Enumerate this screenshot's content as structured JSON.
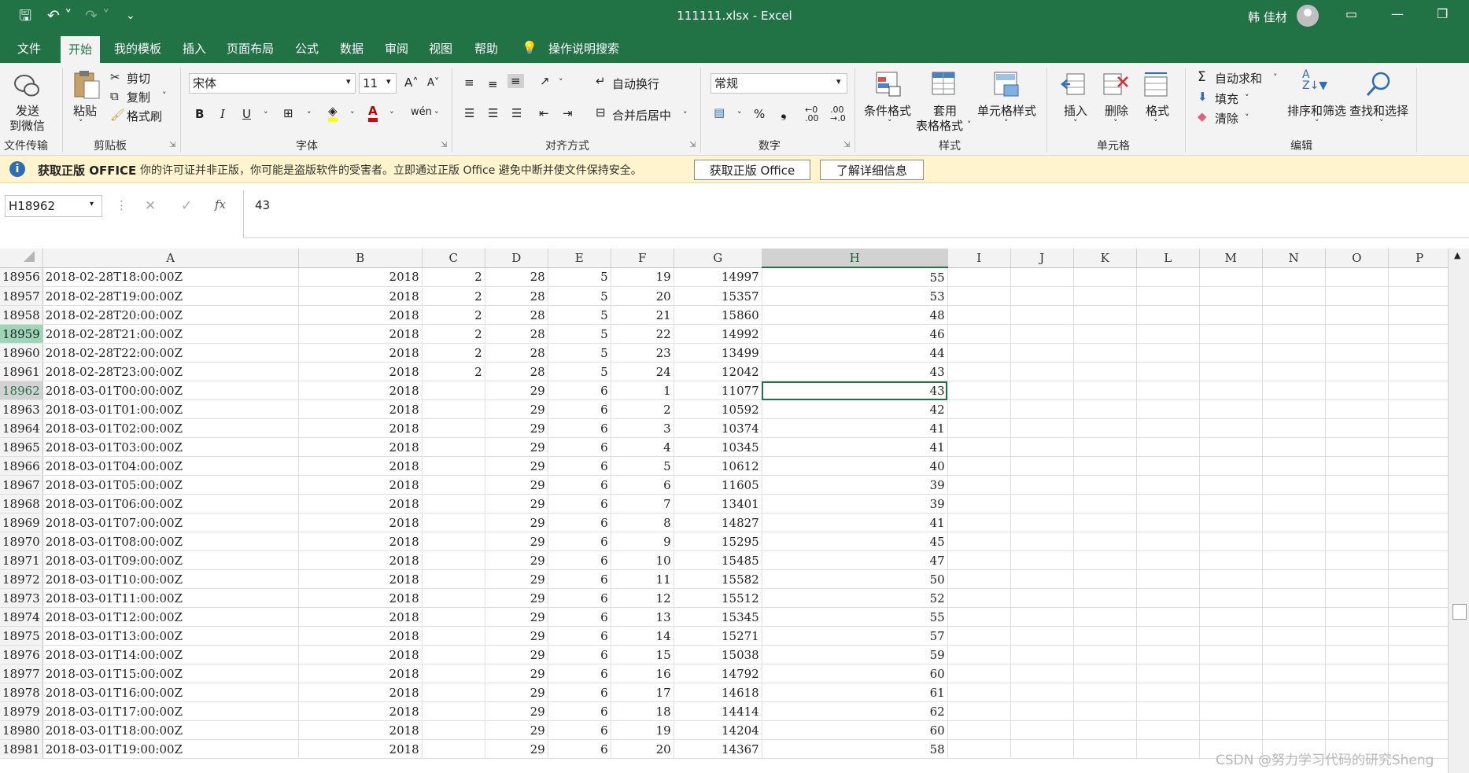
{
  "titlebar": {
    "title": "111111.xlsx  -  Excel",
    "user": "韩 佳材",
    "qa_save": "🖫",
    "qa_undo": "↶ ˅",
    "qa_redo": "↷ ˅",
    "qa_more": "⌄",
    "win_ribbon_opts": "▭",
    "win_min": "—",
    "win_max": "❐"
  },
  "tabs": [
    "文件",
    "开始",
    "我的模板",
    "插入",
    "页面布局",
    "公式",
    "数据",
    "审阅",
    "视图",
    "帮助",
    "操作说明搜索"
  ],
  "active_tab": "开始",
  "ribbon": {
    "send_wechat_1": "发送",
    "send_wechat_2": "到微信",
    "paste": "粘贴",
    "cut": "剪切",
    "copy": "复制",
    "format_painter": "格式刷",
    "font_name": "宋体",
    "font_size": "11",
    "grow": "A˄",
    "shrink": "A˅",
    "bold": "B",
    "italic": "I",
    "underline": "U",
    "wrap_text": "自动换行",
    "merge_center": "合并后居中",
    "number_format": "常规",
    "percent": "%",
    "comma": "❟",
    "cond_format": "条件格式",
    "table_format_1": "套用",
    "table_format_2": "表格格式",
    "cell_styles": "单元格样式",
    "insert": "插入",
    "delete": "删除",
    "format": "格式",
    "autosum": "自动求和",
    "fill": "填充",
    "clear": "清除",
    "sort_filter": "排序和筛选",
    "find_select": "查找和选择",
    "groups": {
      "file_transfer": "文件传输",
      "clipboard": "剪贴板",
      "font": "字体",
      "alignment": "对齐方式",
      "number": "数字",
      "styles": "样式",
      "cells": "单元格",
      "editing": "编辑"
    }
  },
  "notice": {
    "title": "获取正版 OFFICE",
    "text": "你的许可证并非正版，你可能是盗版软件的受害者。立即通过正版 Office 避免中断并使文件保持安全。",
    "button1": "获取正版 Office",
    "button2": "了解详细信息"
  },
  "formula_bar": {
    "name_box": "H18962",
    "value": "43",
    "fx": "fx",
    "cancel": "✕",
    "enter": "✓"
  },
  "columns": [
    "A",
    "B",
    "C",
    "D",
    "E",
    "F",
    "G",
    "H",
    "I",
    "J",
    "K",
    "L",
    "M",
    "N",
    "O",
    "P"
  ],
  "selected_column": "H",
  "rows": [
    {
      "r": "18956",
      "a": "2018-02-28T18:00:00Z",
      "b": "2018",
      "c": "2",
      "d": "28",
      "e": "5",
      "f": "19",
      "g": "14997",
      "h": "55"
    },
    {
      "r": "18957",
      "a": "2018-02-28T19:00:00Z",
      "b": "2018",
      "c": "2",
      "d": "28",
      "e": "5",
      "f": "20",
      "g": "15357",
      "h": "53"
    },
    {
      "r": "18958",
      "a": "2018-02-28T20:00:00Z",
      "b": "2018",
      "c": "2",
      "d": "28",
      "e": "5",
      "f": "21",
      "g": "15860",
      "h": "48"
    },
    {
      "r": "18959",
      "a": "2018-02-28T21:00:00Z",
      "b": "2018",
      "c": "2",
      "d": "28",
      "e": "5",
      "f": "22",
      "g": "14992",
      "h": "46"
    },
    {
      "r": "18960",
      "a": "2018-02-28T22:00:00Z",
      "b": "2018",
      "c": "2",
      "d": "28",
      "e": "5",
      "f": "23",
      "g": "13499",
      "h": "44"
    },
    {
      "r": "18961",
      "a": "2018-02-28T23:00:00Z",
      "b": "2018",
      "c": "2",
      "d": "28",
      "e": "5",
      "f": "24",
      "g": "12042",
      "h": "43"
    },
    {
      "r": "18962",
      "a": "2018-03-01T00:00:00Z",
      "b": "2018",
      "c": "",
      "d": "29",
      "e": "6",
      "f": "1",
      "g": "11077",
      "h": "43"
    },
    {
      "r": "18963",
      "a": "2018-03-01T01:00:00Z",
      "b": "2018",
      "c": "",
      "d": "29",
      "e": "6",
      "f": "2",
      "g": "10592",
      "h": "42"
    },
    {
      "r": "18964",
      "a": "2018-03-01T02:00:00Z",
      "b": "2018",
      "c": "",
      "d": "29",
      "e": "6",
      "f": "3",
      "g": "10374",
      "h": "41"
    },
    {
      "r": "18965",
      "a": "2018-03-01T03:00:00Z",
      "b": "2018",
      "c": "",
      "d": "29",
      "e": "6",
      "f": "4",
      "g": "10345",
      "h": "41"
    },
    {
      "r": "18966",
      "a": "2018-03-01T04:00:00Z",
      "b": "2018",
      "c": "",
      "d": "29",
      "e": "6",
      "f": "5",
      "g": "10612",
      "h": "40"
    },
    {
      "r": "18967",
      "a": "2018-03-01T05:00:00Z",
      "b": "2018",
      "c": "",
      "d": "29",
      "e": "6",
      "f": "6",
      "g": "11605",
      "h": "39"
    },
    {
      "r": "18968",
      "a": "2018-03-01T06:00:00Z",
      "b": "2018",
      "c": "",
      "d": "29",
      "e": "6",
      "f": "7",
      "g": "13401",
      "h": "39"
    },
    {
      "r": "18969",
      "a": "2018-03-01T07:00:00Z",
      "b": "2018",
      "c": "",
      "d": "29",
      "e": "6",
      "f": "8",
      "g": "14827",
      "h": "41"
    },
    {
      "r": "18970",
      "a": "2018-03-01T08:00:00Z",
      "b": "2018",
      "c": "",
      "d": "29",
      "e": "6",
      "f": "9",
      "g": "15295",
      "h": "45"
    },
    {
      "r": "18971",
      "a": "2018-03-01T09:00:00Z",
      "b": "2018",
      "c": "",
      "d": "29",
      "e": "6",
      "f": "10",
      "g": "15485",
      "h": "47"
    },
    {
      "r": "18972",
      "a": "2018-03-01T10:00:00Z",
      "b": "2018",
      "c": "",
      "d": "29",
      "e": "6",
      "f": "11",
      "g": "15582",
      "h": "50"
    },
    {
      "r": "18973",
      "a": "2018-03-01T11:00:00Z",
      "b": "2018",
      "c": "",
      "d": "29",
      "e": "6",
      "f": "12",
      "g": "15512",
      "h": "52"
    },
    {
      "r": "18974",
      "a": "2018-03-01T12:00:00Z",
      "b": "2018",
      "c": "",
      "d": "29",
      "e": "6",
      "f": "13",
      "g": "15345",
      "h": "55"
    },
    {
      "r": "18975",
      "a": "2018-03-01T13:00:00Z",
      "b": "2018",
      "c": "",
      "d": "29",
      "e": "6",
      "f": "14",
      "g": "15271",
      "h": "57"
    },
    {
      "r": "18976",
      "a": "2018-03-01T14:00:00Z",
      "b": "2018",
      "c": "",
      "d": "29",
      "e": "6",
      "f": "15",
      "g": "15038",
      "h": "59"
    },
    {
      "r": "18977",
      "a": "2018-03-01T15:00:00Z",
      "b": "2018",
      "c": "",
      "d": "29",
      "e": "6",
      "f": "16",
      "g": "14792",
      "h": "60"
    },
    {
      "r": "18978",
      "a": "2018-03-01T16:00:00Z",
      "b": "2018",
      "c": "",
      "d": "29",
      "e": "6",
      "f": "17",
      "g": "14618",
      "h": "61"
    },
    {
      "r": "18979",
      "a": "2018-03-01T17:00:00Z",
      "b": "2018",
      "c": "",
      "d": "29",
      "e": "6",
      "f": "18",
      "g": "14414",
      "h": "62"
    },
    {
      "r": "18980",
      "a": "2018-03-01T18:00:00Z",
      "b": "2018",
      "c": "",
      "d": "29",
      "e": "6",
      "f": "19",
      "g": "14204",
      "h": "60"
    },
    {
      "r": "18981",
      "a": "2018-03-01T19:00:00Z",
      "b": "2018",
      "c": "",
      "d": "29",
      "e": "6",
      "f": "20",
      "g": "14367",
      "h": "58"
    }
  ],
  "active_row": "18962",
  "highlight_row": "18959",
  "watermark": "CSDN @努力学习代码的研究Sheng"
}
